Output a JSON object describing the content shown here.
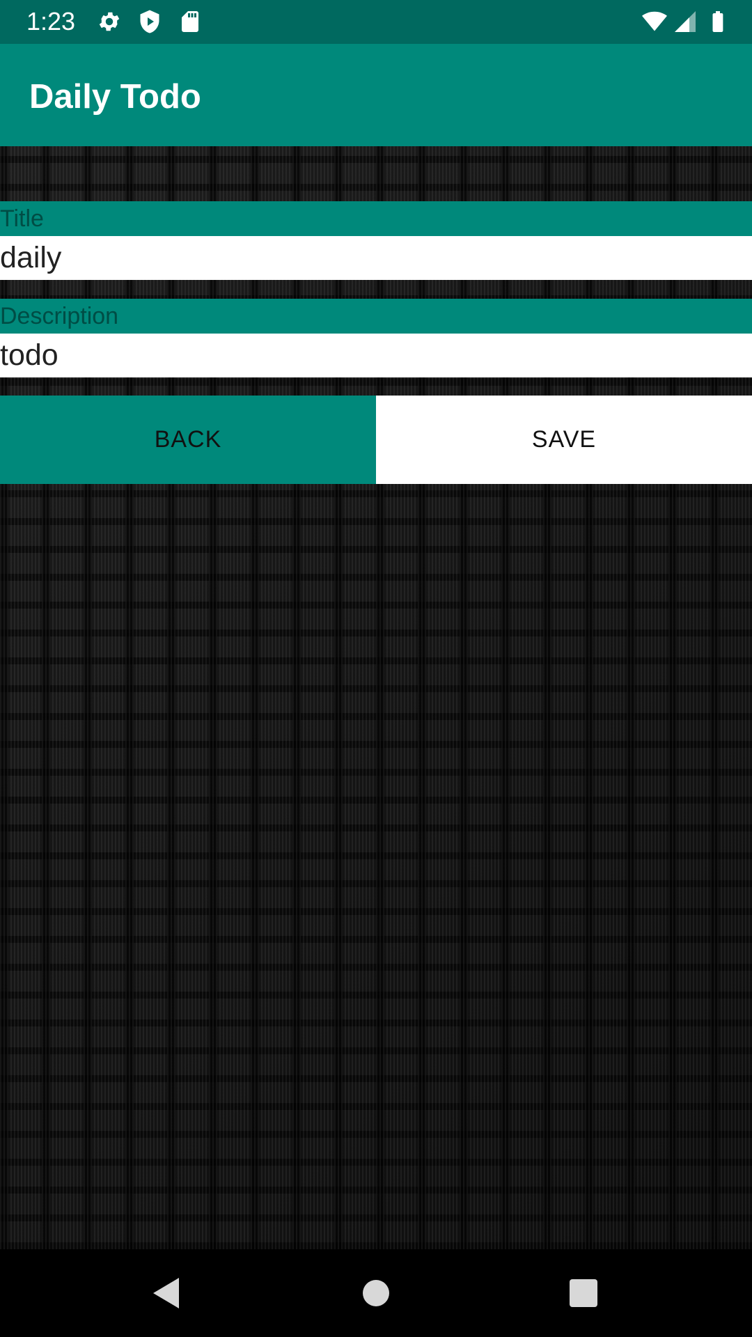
{
  "status_bar": {
    "time": "1:23",
    "icons": [
      "settings-icon",
      "shield-icon",
      "sd-card-icon",
      "wifi-icon",
      "signal-icon",
      "battery-icon"
    ]
  },
  "app_bar": {
    "title": "Daily Todo"
  },
  "form": {
    "title_label": "Title",
    "title_value": "daily",
    "description_label": "Description",
    "description_value": "todo"
  },
  "buttons": {
    "back": "BACK",
    "save": "SAVE"
  },
  "nav_bar": {
    "icons": [
      "back-icon",
      "home-icon",
      "recents-icon"
    ]
  },
  "colors": {
    "primary": "#00897b",
    "primary_dark": "#00695f",
    "label_text": "#004d45"
  }
}
